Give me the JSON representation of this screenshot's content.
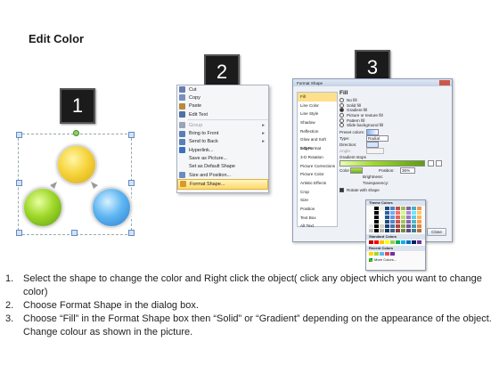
{
  "title": "Edit Color",
  "steps_badges": [
    "1",
    "2",
    "3"
  ],
  "context_menu": {
    "items": [
      {
        "label": "Cut",
        "color": "#6a7fb0"
      },
      {
        "label": "Copy",
        "color": "#7a8fc0"
      },
      {
        "label": "Paste",
        "color": "#b98a3c"
      },
      {
        "label": "Edit Text",
        "color": "#4f6fa8"
      },
      {
        "label": "Group",
        "color": "#9aa4b8",
        "arrow": true,
        "disabled": true
      },
      {
        "label": "Bring to Front",
        "color": "#5a7fb8",
        "arrow": true
      },
      {
        "label": "Send to Back",
        "color": "#5a7fb8",
        "arrow": true
      },
      {
        "label": "Hyperlink...",
        "color": "#3b6fc0"
      },
      {
        "label": "Save as Picture...",
        "color": ""
      },
      {
        "label": "Set as Default Shape",
        "color": ""
      },
      {
        "label": "Size and Position...",
        "color": "#6c8cc0"
      },
      {
        "label": "Format Shape...",
        "color": "#d69a2c",
        "highlighted": true
      }
    ]
  },
  "dialog": {
    "title": "Format Shape",
    "categories": [
      "Fill",
      "Line Color",
      "Line Style",
      "Shadow",
      "Reflection",
      "Glow and Soft Edges",
      "3-D Format",
      "3-D Rotation",
      "Picture Corrections",
      "Picture Color",
      "Artistic Effects",
      "Crop",
      "Size",
      "Position",
      "Text Box",
      "Alt Text"
    ],
    "section": "Fill",
    "options": [
      "No fill",
      "Solid fill",
      "Gradient fill",
      "Picture or texture fill",
      "Pattern fill",
      "Slide background fill"
    ],
    "selected_option": "Gradient fill",
    "preset_label": "Preset colors:",
    "type_label": "Type:",
    "type_value": "Radial",
    "direction_label": "Direction:",
    "angle_label": "Angle:",
    "stops_label": "Gradient stops",
    "color_label": "Color",
    "position_label": "Position:",
    "position_value": "36%",
    "brightness_label": "Brightness:",
    "transparency_label": "Transparency:",
    "rotate_label": "Rotate with shape",
    "close_label": "Close"
  },
  "palette": {
    "theme_label": "Theme Colors",
    "standard_label": "Standard Colors",
    "recent_label": "Recent Colors",
    "more_label": "More Colors..."
  },
  "instructions": [
    {
      "num": "1.",
      "text": "Select the shape to change the color and Right click the object( click any object which you want to change color)"
    },
    {
      "num": "2.",
      "text": "Choose Format Shape in the dialog box."
    },
    {
      "num": "3.",
      "text": "Choose “Fill” in the Format Shape box then “Solid” or “Gradient” depending on the appearance of the object. Change colour as shown in the picture."
    }
  ]
}
